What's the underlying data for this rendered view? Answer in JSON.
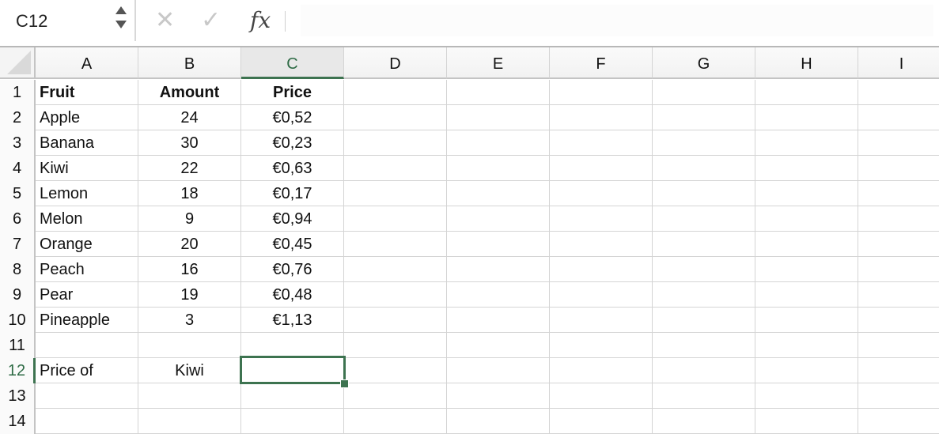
{
  "formula_bar": {
    "name_box": "C12",
    "cancel_icon": "✕",
    "enter_icon": "✓",
    "fx_label": "fx",
    "formula": ""
  },
  "columns": [
    "A",
    "B",
    "C",
    "D",
    "E",
    "F",
    "G",
    "H",
    "I"
  ],
  "selected_column": "C",
  "selected_row": 12,
  "selected_cell": "C12",
  "rows": [
    {
      "num": "1",
      "A": "Fruit",
      "B": "Amount",
      "C": "Price",
      "bold": true
    },
    {
      "num": "2",
      "A": "Apple",
      "B": "24",
      "C": "€0,52"
    },
    {
      "num": "3",
      "A": "Banana",
      "B": "30",
      "C": "€0,23"
    },
    {
      "num": "4",
      "A": "Kiwi",
      "B": "22",
      "C": "€0,63"
    },
    {
      "num": "5",
      "A": "Lemon",
      "B": "18",
      "C": "€0,17"
    },
    {
      "num": "6",
      "A": "Melon",
      "B": "9",
      "C": "€0,94"
    },
    {
      "num": "7",
      "A": "Orange",
      "B": "20",
      "C": "€0,45"
    },
    {
      "num": "8",
      "A": "Peach",
      "B": "16",
      "C": "€0,76"
    },
    {
      "num": "9",
      "A": "Pear",
      "B": "19",
      "C": "€0,48"
    },
    {
      "num": "10",
      "A": "Pineapple",
      "B": "3",
      "C": "€1,13"
    },
    {
      "num": "11",
      "A": "",
      "B": "",
      "C": ""
    },
    {
      "num": "12",
      "A": "Price of",
      "B": "Kiwi",
      "C": ""
    },
    {
      "num": "13",
      "A": "",
      "B": "",
      "C": ""
    },
    {
      "num": "14",
      "A": "",
      "B": "",
      "C": ""
    }
  ],
  "colors": {
    "selection": "#3d7350",
    "gridline": "#d4d4d4",
    "header_bg": "#f2f2f2"
  }
}
